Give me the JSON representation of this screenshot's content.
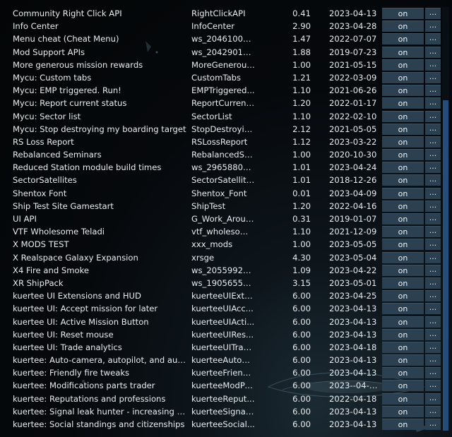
{
  "mods": [
    {
      "name": "Community Right Click API",
      "id": "RightClickAPI",
      "version": "0.41",
      "date": "2023-04-13",
      "state": "on",
      "more": "..."
    },
    {
      "name": "Info Center",
      "id": "InfoCenter",
      "version": "2.90",
      "date": "2023-04-28",
      "state": "on",
      "more": "..."
    },
    {
      "name": "Menu cheat (Cheat Menu)",
      "id": "ws_20461000...",
      "version": "1.47",
      "date": "2022-07-07",
      "state": "on",
      "more": "..."
    },
    {
      "name": "Mod Support APIs",
      "id": "ws_20429012...",
      "version": "1.88",
      "date": "2019-07-23",
      "state": "on",
      "more": "..."
    },
    {
      "name": "More generous mission rewards",
      "id": "MoreGenerous...",
      "version": "1.00",
      "date": "2021-05-15",
      "state": "on",
      "more": "..."
    },
    {
      "name": "Mycu: Custom tabs",
      "id": "CustomTabs",
      "version": "1.21",
      "date": "2022-03-09",
      "state": "on",
      "more": "..."
    },
    {
      "name": "Mycu: EMP triggered. Run!",
      "id": "EMPTriggered...",
      "version": "1.10",
      "date": "2021-06-26",
      "state": "on",
      "more": "..."
    },
    {
      "name": "Mycu: Report current status",
      "id": "ReportCurrent...",
      "version": "1.20",
      "date": "2022-01-17",
      "state": "on",
      "more": "..."
    },
    {
      "name": "Mycu: Sector list",
      "id": "SectorList",
      "version": "1.10",
      "date": "2022-02-10",
      "state": "on",
      "more": "..."
    },
    {
      "name": "Mycu: Stop destroying my boarding target",
      "id": "StopDestroyin...",
      "version": "2.12",
      "date": "2021-05-05",
      "state": "on",
      "more": "..."
    },
    {
      "name": "RS Loss Report",
      "id": "RSLossReport",
      "version": "1.12",
      "date": "2023-03-22",
      "state": "on",
      "more": "..."
    },
    {
      "name": "Rebalanced Seminars",
      "id": "RebalancedSe...",
      "version": "1.00",
      "date": "2020-10-30",
      "state": "on",
      "more": "..."
    },
    {
      "name": "Reduced Station module build times",
      "id": "ws_29658802...",
      "version": "1.01",
      "date": "2023-04-24",
      "state": "on",
      "more": "..."
    },
    {
      "name": "SectorSatellites",
      "id": "SectorSatellites",
      "version": "1.01",
      "date": "2018-12-26",
      "state": "on",
      "more": "..."
    },
    {
      "name": "Shentox Font",
      "id": "Shentox_Font",
      "version": "0.01",
      "date": "2023-04-09",
      "state": "on",
      "more": "..."
    },
    {
      "name": "Ship Test Site Gamestart",
      "id": "ShipTest",
      "version": "1.20",
      "date": "2022-04-16",
      "state": "on",
      "more": "..."
    },
    {
      "name": "UI API",
      "id": "G_Work_Around",
      "version": "0.31",
      "date": "2019-01-07",
      "state": "on",
      "more": "..."
    },
    {
      "name": "VTF Wholesome Teladi",
      "id": "vtf_wholesom...",
      "version": "1.10",
      "date": "2021-12-09",
      "state": "on",
      "more": "..."
    },
    {
      "name": "X MODS TEST",
      "id": "xxx_mods",
      "version": "1.00",
      "date": "2023-05-05",
      "state": "on",
      "more": "..."
    },
    {
      "name": "X Realspace Galaxy Expansion",
      "id": "xrsge",
      "version": "4.30",
      "date": "2023-05-04",
      "state": "on",
      "more": "..."
    },
    {
      "name": "X4 Fire and Smoke",
      "id": "ws_20559928...",
      "version": "1.09",
      "date": "2023-04-22",
      "state": "on",
      "more": "..."
    },
    {
      "name": "XR ShipPack",
      "id": "ws_19056558...",
      "version": "3.15",
      "date": "2023-05-01",
      "state": "on",
      "more": "..."
    },
    {
      "name": "kuertee UI Extensions and HUD",
      "id": "kuerteeUIExte...",
      "version": "6.00",
      "date": "2023-04-25",
      "state": "on",
      "more": "..."
    },
    {
      "name": "kuertee UI: Accept mission for later",
      "id": "kuerteeUIAcc...",
      "version": "6.00",
      "date": "2023-04-13",
      "state": "on",
      "more": "..."
    },
    {
      "name": "kuertee UI: Active Mission Button",
      "id": "kuerteeUIActi...",
      "version": "6.00",
      "date": "2023-04-13",
      "state": "on",
      "more": "..."
    },
    {
      "name": "kuertee UI: Reset mouse",
      "id": "kuerteeUIRes...",
      "version": "6.00",
      "date": "2023-04-13",
      "state": "on",
      "more": "..."
    },
    {
      "name": "kuertee UI: Trade analytics",
      "id": "kuerteeUITrad...",
      "version": "6.00",
      "date": "2023-04-18",
      "state": "on",
      "more": "..."
    },
    {
      "name": "kuertee: Auto-camera, autopilot, and auto-...",
      "id": "kuerteeAutoC...",
      "version": "6.00",
      "date": "2023-04-13",
      "state": "on",
      "more": "..."
    },
    {
      "name": "kuertee: Friendly fire tweaks",
      "id": "kuerteeFriend...",
      "version": "6.00",
      "date": "2023-04-13",
      "state": "on",
      "more": "..."
    },
    {
      "name": "kuertee: Modifications parts trader",
      "id": "kuerteeModPa...",
      "version": "6.00",
      "date": "2023--04-13",
      "state": "on",
      "more": "..."
    },
    {
      "name": "kuertee: Reputations and professions",
      "id": "kuerteeReput...",
      "version": "6.00",
      "date": "2022-04-18",
      "state": "on",
      "more": "..."
    },
    {
      "name": "kuertee: Signal leak hunter - increasing ra...",
      "id": "kuerteeSignal...",
      "version": "6.00",
      "date": "2023-04-13",
      "state": "on",
      "more": "..."
    },
    {
      "name": "kuertee: Social standings and citizenships",
      "id": "kuerteeSocial...",
      "version": "6.00",
      "date": "2023-04-13",
      "state": "on",
      "more": "..."
    }
  ]
}
